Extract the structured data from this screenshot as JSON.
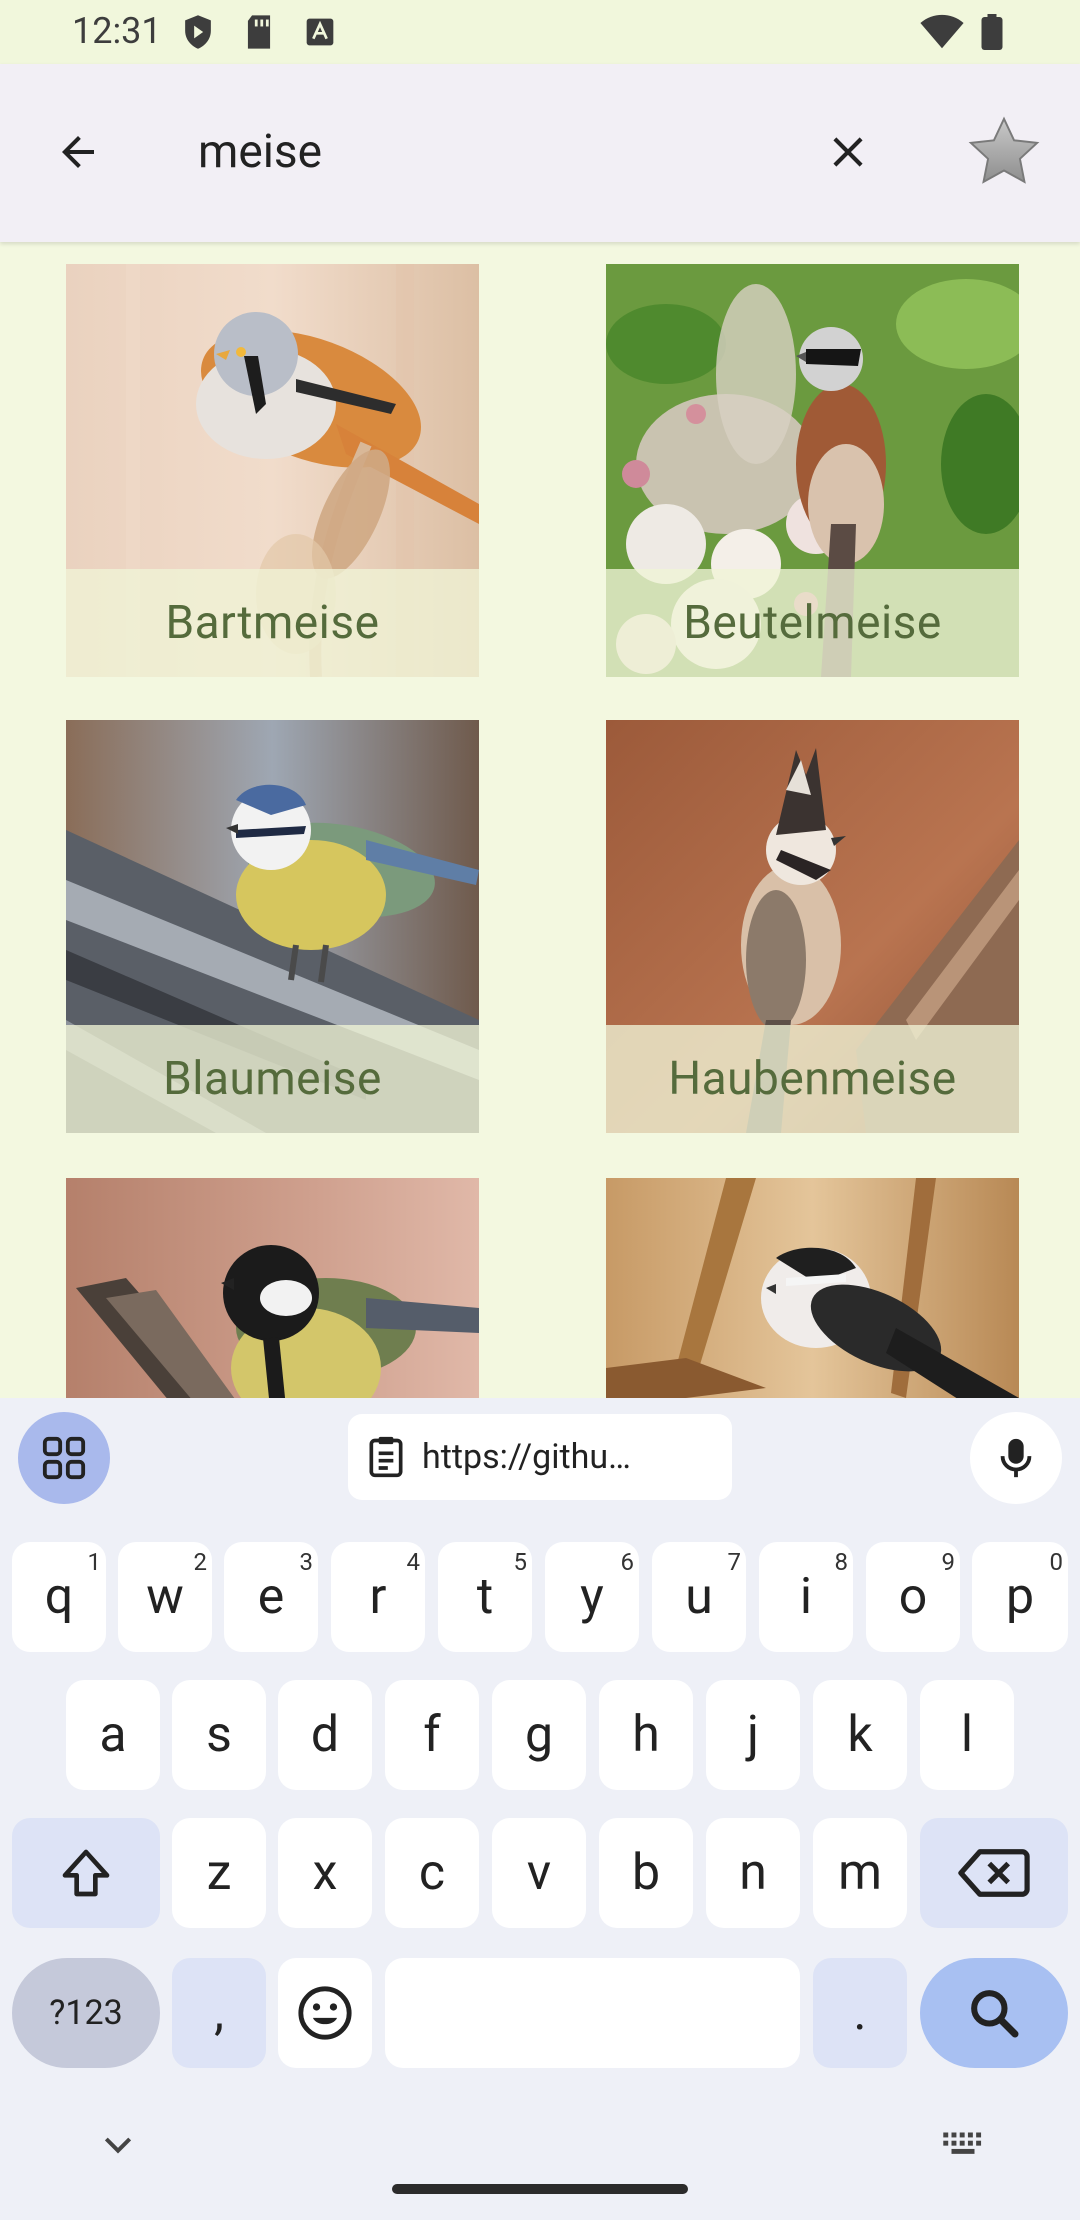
{
  "status_bar": {
    "time": "12:31"
  },
  "search": {
    "value": "meise",
    "placeholder": ""
  },
  "results": [
    {
      "name": "Bartmeise"
    },
    {
      "name": "Beutelmeise"
    },
    {
      "name": "Blaumeise"
    },
    {
      "name": "Haubenmeise"
    },
    {
      "name": ""
    },
    {
      "name": ""
    }
  ],
  "keyboard": {
    "clipboard_text": "https://githu…",
    "row1": [
      "q",
      "w",
      "e",
      "r",
      "t",
      "y",
      "u",
      "i",
      "o",
      "p"
    ],
    "row1_hints": [
      "1",
      "2",
      "3",
      "4",
      "5",
      "6",
      "7",
      "8",
      "9",
      "0"
    ],
    "row2": [
      "a",
      "s",
      "d",
      "f",
      "g",
      "h",
      "j",
      "k",
      "l"
    ],
    "row3": [
      "z",
      "x",
      "c",
      "v",
      "b",
      "n",
      "m"
    ],
    "symbols_label": "?123",
    "comma": ",",
    "period": "."
  },
  "colors": {
    "background": "#f3f8e0",
    "app_bar": "#f2eff5",
    "label_text": "#556b3c",
    "keyboard_bg": "#eef0f7",
    "accent_key": "#a8c0f2"
  }
}
